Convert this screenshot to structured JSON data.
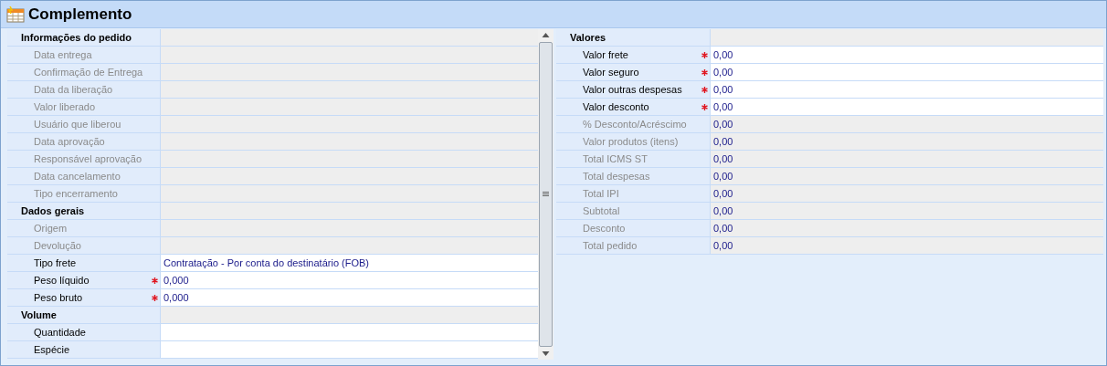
{
  "title": "Complemento",
  "panels": [
    {
      "rows": [
        {
          "kind": "group",
          "label": "Informações do pedido"
        },
        {
          "kind": "field",
          "label": "Data entrega",
          "required": false,
          "disabled": true
        },
        {
          "kind": "field",
          "label": "Confirmação de Entrega",
          "required": false,
          "disabled": true
        },
        {
          "kind": "field",
          "label": "Data da liberação",
          "required": false,
          "disabled": true
        },
        {
          "kind": "field",
          "label": "Valor liberado",
          "required": false,
          "disabled": true
        },
        {
          "kind": "field",
          "label": "Usuário que liberou",
          "required": false,
          "disabled": true
        },
        {
          "kind": "field",
          "label": "Data aprovação",
          "required": false,
          "disabled": true
        },
        {
          "kind": "field",
          "label": "Responsável aprovação",
          "required": false,
          "disabled": true
        },
        {
          "kind": "field",
          "label": "Data cancelamento",
          "required": false,
          "disabled": true
        },
        {
          "kind": "field",
          "label": "Tipo encerramento",
          "required": false,
          "disabled": true
        },
        {
          "kind": "group",
          "label": "Dados gerais"
        },
        {
          "kind": "field",
          "label": "Origem",
          "required": false,
          "disabled": true
        },
        {
          "kind": "field",
          "label": "Devolução",
          "required": false,
          "disabled": true
        },
        {
          "kind": "field",
          "label": "Tipo frete",
          "value": "Contratação - Por conta do destinatário (FOB)",
          "required": false,
          "disabled": false
        },
        {
          "kind": "field",
          "label": "Peso líquido",
          "value": "0,000",
          "required": true,
          "disabled": false
        },
        {
          "kind": "field",
          "label": "Peso bruto",
          "value": "0,000",
          "required": true,
          "disabled": false
        },
        {
          "kind": "group",
          "label": "Volume"
        },
        {
          "kind": "field",
          "label": "Quantidade",
          "required": false,
          "disabled": false
        },
        {
          "kind": "field",
          "label": "Espécie",
          "required": false,
          "disabled": false
        }
      ]
    },
    {
      "rows": [
        {
          "kind": "group",
          "label": "Valores"
        },
        {
          "kind": "field",
          "label": "Valor frete",
          "value": "0,00",
          "required": true,
          "disabled": false
        },
        {
          "kind": "field",
          "label": "Valor seguro",
          "value": "0,00",
          "required": true,
          "disabled": false
        },
        {
          "kind": "field",
          "label": "Valor outras despesas",
          "value": "0,00",
          "required": true,
          "disabled": false
        },
        {
          "kind": "field",
          "label": "Valor desconto",
          "value": "0,00",
          "required": true,
          "disabled": false
        },
        {
          "kind": "field",
          "label": "% Desconto/Acréscimo",
          "value": "0,00",
          "required": false,
          "disabled": true
        },
        {
          "kind": "field",
          "label": "Valor produtos (itens)",
          "value": "0,00",
          "required": false,
          "disabled": true
        },
        {
          "kind": "field",
          "label": "Total ICMS ST",
          "value": "0,00",
          "required": false,
          "disabled": true
        },
        {
          "kind": "field",
          "label": "Total despesas",
          "value": "0,00",
          "required": false,
          "disabled": true
        },
        {
          "kind": "field",
          "label": "Total IPI",
          "value": "0,00",
          "required": false,
          "disabled": true
        },
        {
          "kind": "field",
          "label": "Subtotal",
          "value": "0,00",
          "required": false,
          "disabled": true
        },
        {
          "kind": "field",
          "label": "Desconto",
          "value": "0,00",
          "required": false,
          "disabled": true
        },
        {
          "kind": "field",
          "label": "Total pedido",
          "value": "0,00",
          "required": false,
          "disabled": true
        }
      ]
    }
  ]
}
